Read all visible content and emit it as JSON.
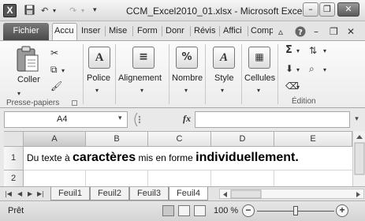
{
  "window": {
    "title": "CCM_Excel2010_01.xlsx  -  Microsoft Excel",
    "app_icon": "X",
    "controls": {
      "minimize": "–",
      "restore": "❐",
      "close": "✕"
    }
  },
  "ribbon_tabs": {
    "file": "Fichier",
    "tabs": [
      {
        "label": "Accu",
        "active": true
      },
      {
        "label": "Inser"
      },
      {
        "label": "Mise"
      },
      {
        "label": "Form"
      },
      {
        "label": "Donr"
      },
      {
        "label": "Révis"
      },
      {
        "label": "Affici"
      },
      {
        "label": "Comp"
      }
    ]
  },
  "ribbon": {
    "clipboard": {
      "paste_label": "Coller",
      "group_label": "Presse-papiers"
    },
    "font": {
      "label": "Police"
    },
    "alignment": {
      "label": "Alignement"
    },
    "number": {
      "label": "Nombre",
      "glyph": "%"
    },
    "style": {
      "label": "Style"
    },
    "cells": {
      "label": "Cellules"
    },
    "editing": {
      "group_label": "Édition"
    }
  },
  "formula_bar": {
    "name_box": "A4",
    "fx": "fx",
    "formula": ""
  },
  "grid": {
    "columns": [
      "A",
      "B",
      "C",
      "D",
      "E"
    ],
    "selected_column": "A",
    "rows": [
      "1",
      "2"
    ],
    "a1_parts": [
      {
        "text": "Du texte à ",
        "style": "small"
      },
      {
        "text": "caractères",
        "style": "big"
      },
      {
        "text": " mis en forme ",
        "style": "small"
      },
      {
        "text": "individuellement.",
        "style": "big"
      }
    ]
  },
  "sheets": {
    "tabs": [
      "Feuil1",
      "Feuil2",
      "Feuil3",
      "Feuil4"
    ],
    "active": "Feuil4"
  },
  "status": {
    "ready": "Prêt",
    "zoom": "100 %",
    "zoom_level_percent": 100
  }
}
